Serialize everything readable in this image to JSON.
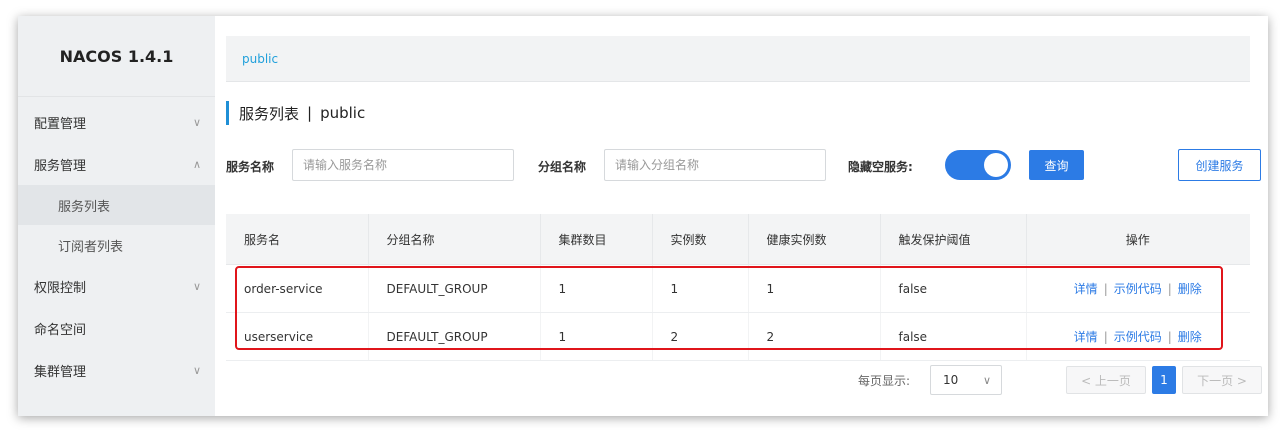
{
  "app": {
    "title": "NACOS 1.4.1"
  },
  "sidebar": {
    "items": [
      {
        "label": "配置管理",
        "chevron": "∨"
      },
      {
        "label": "服务管理",
        "chevron": "∧"
      },
      {
        "label": "权限控制",
        "chevron": "∨"
      },
      {
        "label": "命名空间",
        "chevron": ""
      },
      {
        "label": "集群管理",
        "chevron": "∨"
      }
    ],
    "sub_items": [
      {
        "label": "服务列表",
        "active": true
      },
      {
        "label": "订阅者列表",
        "active": false
      }
    ]
  },
  "namespace_bar": {
    "label": "public"
  },
  "page": {
    "title": "服务列表",
    "separator": "|",
    "namespace": "public"
  },
  "search": {
    "service_name_label": "服务名称",
    "service_name_placeholder": "请输入服务名称",
    "group_name_label": "分组名称",
    "group_name_placeholder": "请输入分组名称",
    "hide_empty_label": "隐藏空服务:",
    "hide_empty_on": true,
    "query_button": "查询",
    "create_button": "创建服务"
  },
  "table": {
    "columns": [
      "服务名",
      "分组名称",
      "集群数目",
      "实例数",
      "健康实例数",
      "触发保护阈值",
      "操作"
    ],
    "rows": [
      {
        "service": "order-service",
        "group": "DEFAULT_GROUP",
        "clusters": "1",
        "instances": "1",
        "healthy": "1",
        "threshold": "false"
      },
      {
        "service": "userservice",
        "group": "DEFAULT_GROUP",
        "clusters": "1",
        "instances": "2",
        "healthy": "2",
        "threshold": "false"
      }
    ],
    "actions": {
      "detail": "详情",
      "sample": "示例代码",
      "delete": "删除",
      "sep": "|"
    }
  },
  "pagination": {
    "per_page_label": "每页显示:",
    "per_page_value": "10",
    "prev": "< 上一页",
    "current": "1",
    "next": "下一页 >"
  },
  "colors": {
    "accent": "#2c7be5",
    "link": "#21a0db",
    "highlight": "#e0151b"
  }
}
